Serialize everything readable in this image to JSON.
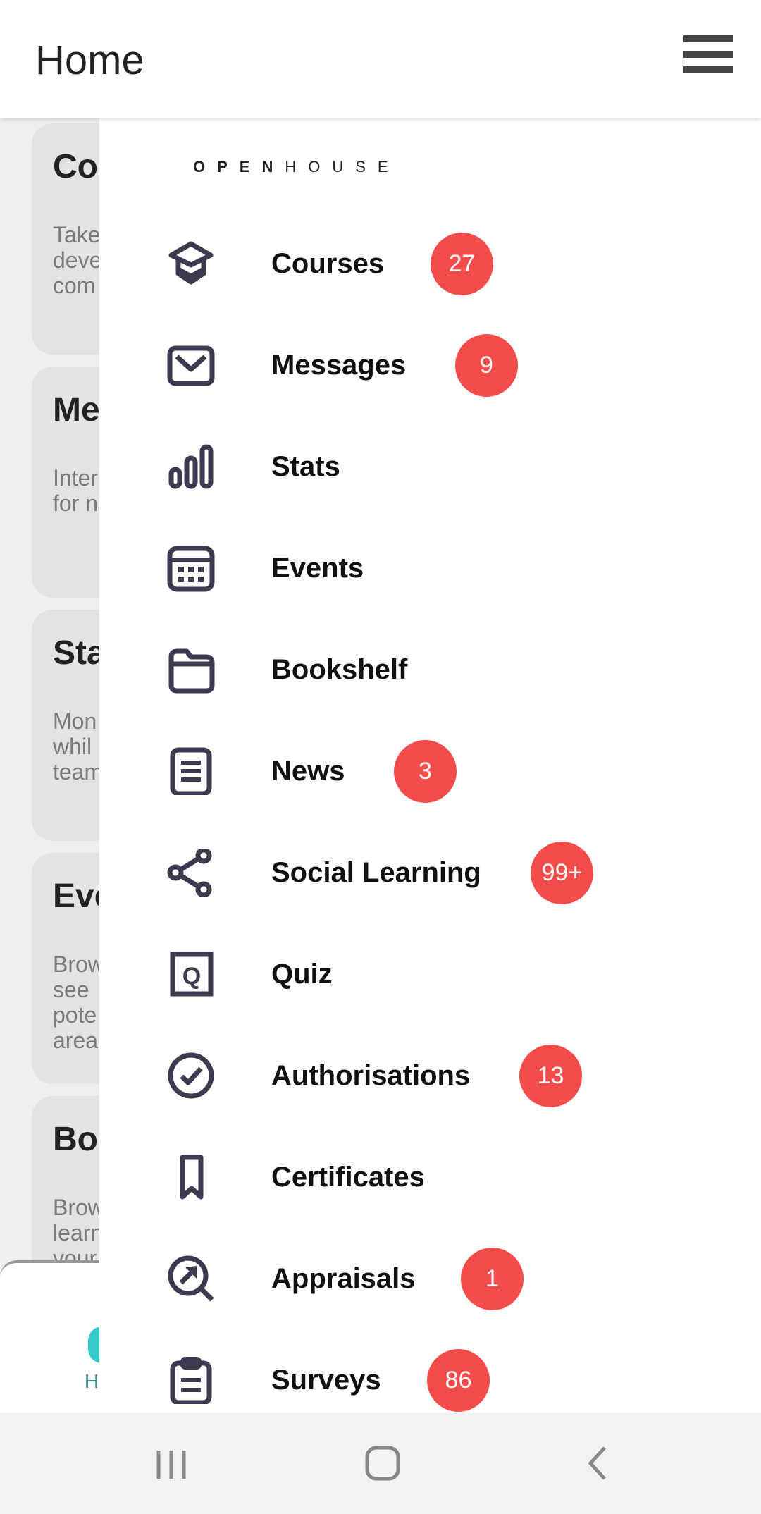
{
  "header": {
    "title": "Home",
    "menu_icon": "hamburger-icon"
  },
  "background_cards": [
    {
      "title": "Co",
      "desc": [
        "Take",
        "deve",
        "com"
      ]
    },
    {
      "title": "Me",
      "desc": [
        "Inter",
        "for n"
      ]
    },
    {
      "title": "Sta",
      "desc": [
        "Mon",
        "whil",
        "team"
      ]
    },
    {
      "title": "Eve",
      "desc": [
        "Brow",
        "see",
        "pote",
        "area"
      ]
    },
    {
      "title": "Bo",
      "desc": [
        "Brow",
        "learn",
        "your"
      ]
    }
  ],
  "tabbar": {
    "label": "H",
    "accent": "#35c9c9"
  },
  "drawer": {
    "logo": {
      "bold": "OPEN",
      "light": "HOUSE"
    },
    "badge_color": "#f44b4b",
    "icon_color": "#3d3a4f",
    "items": [
      {
        "label": "Courses",
        "icon": "graduation-cap-icon",
        "badge": "27"
      },
      {
        "label": "Messages",
        "icon": "envelope-icon",
        "badge": "9"
      },
      {
        "label": "Stats",
        "icon": "bar-chart-icon",
        "badge": null
      },
      {
        "label": "Events",
        "icon": "calendar-icon",
        "badge": null
      },
      {
        "label": "Bookshelf",
        "icon": "folder-icon",
        "badge": null
      },
      {
        "label": "News",
        "icon": "document-icon",
        "badge": "3"
      },
      {
        "label": "Social Learning",
        "icon": "share-icon",
        "badge": "99+"
      },
      {
        "label": "Quiz",
        "icon": "quiz-icon",
        "badge": null
      },
      {
        "label": "Authorisations",
        "icon": "check-circle-icon",
        "badge": "13"
      },
      {
        "label": "Certificates",
        "icon": "bookmark-icon",
        "badge": null
      },
      {
        "label": "Appraisals",
        "icon": "search-arrow-icon",
        "badge": "1"
      },
      {
        "label": "Surveys",
        "icon": "clipboard-icon",
        "badge": "86"
      }
    ]
  },
  "navbar": {
    "icons": [
      "recent-apps-icon",
      "home-icon",
      "back-icon"
    ]
  }
}
